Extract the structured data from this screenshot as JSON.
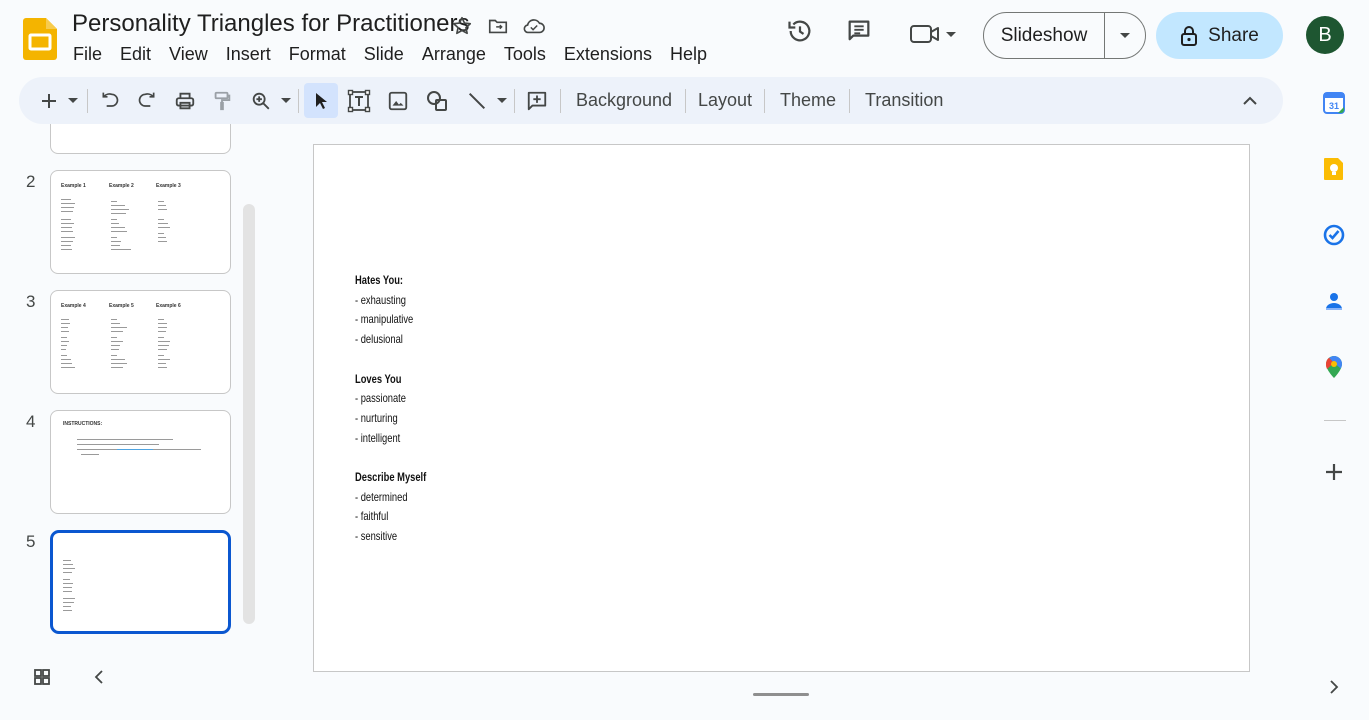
{
  "app": {
    "doc_title": "Personality Triangles for Practitioners",
    "brand_color": "#f4b400",
    "avatar_letter": "B"
  },
  "menu": [
    "File",
    "Edit",
    "View",
    "Insert",
    "Format",
    "Slide",
    "Arrange",
    "Tools",
    "Extensions",
    "Help"
  ],
  "header_buttons": {
    "slideshow_label": "Slideshow",
    "share_label": "Share"
  },
  "toolbar": {
    "background_label": "Background",
    "layout_label": "Layout",
    "theme_label": "Theme",
    "transition_label": "Transition"
  },
  "filmstrip": {
    "slide_numbers": [
      "2",
      "3",
      "4",
      "5"
    ],
    "slide2_headers": [
      "Example 1",
      "Example 2",
      "Example 3"
    ],
    "slide3_headers": [
      "Example 4",
      "Example 5",
      "Example 6"
    ],
    "slide4_heading": "INSTRUCTIONS:",
    "selected_slide": "5"
  },
  "slide": {
    "sections": [
      {
        "heading": "Hates You:",
        "items": [
          "- exhausting",
          "- manipulative",
          "- delusional"
        ]
      },
      {
        "heading": "Loves You",
        "items": [
          "- passionate",
          "- nurturing",
          "- intelligent"
        ]
      },
      {
        "heading": "Describe Myself",
        "items": [
          "- determined",
          "- faithful",
          "- sensitive"
        ]
      }
    ]
  },
  "icons": {
    "title": [
      "star-icon",
      "move-folder-icon",
      "cloud-saved-icon"
    ],
    "header": [
      "history-icon",
      "comments-icon",
      "video-call-icon"
    ],
    "side_panel": [
      "calendar-icon",
      "keep-icon",
      "tasks-icon",
      "contacts-icon",
      "maps-icon",
      "add-icon"
    ]
  }
}
